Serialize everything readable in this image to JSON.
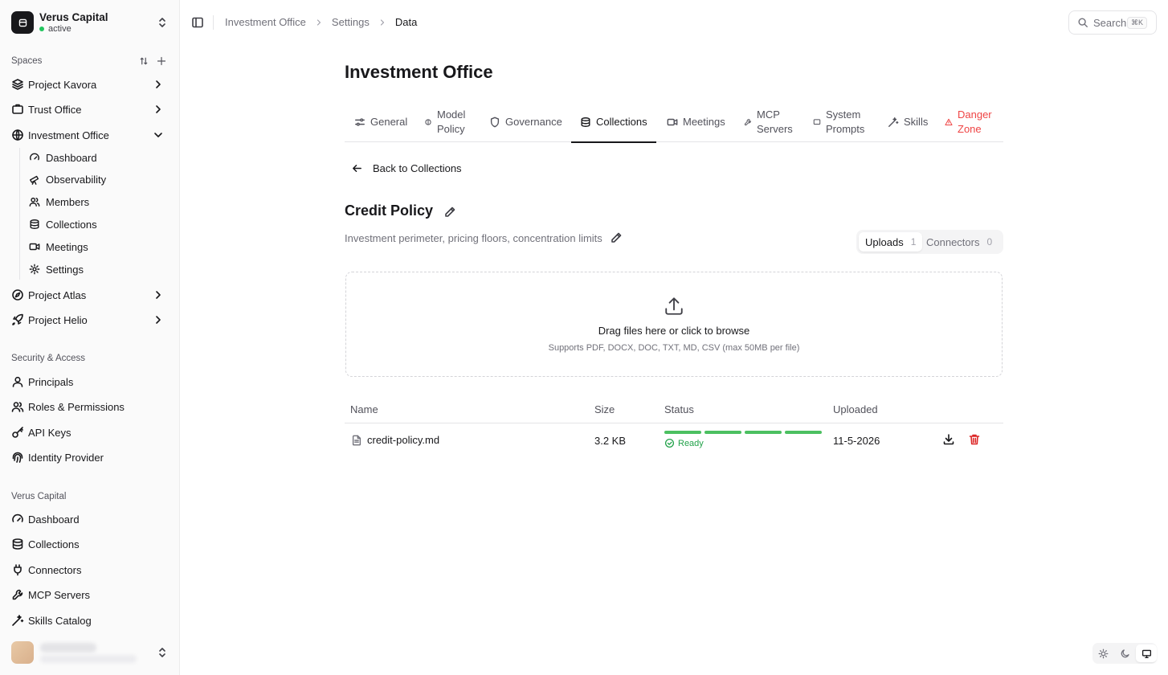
{
  "org": {
    "name": "Verus Capital",
    "status": "active"
  },
  "sidebar": {
    "spaces_label": "Spaces",
    "spaces": [
      {
        "label": "Project Kavora",
        "icon": "layers-icon"
      },
      {
        "label": "Trust Office",
        "icon": "building-icon"
      },
      {
        "label": "Investment Office",
        "icon": "globe-icon"
      }
    ],
    "investment_office_items": [
      {
        "label": "Dashboard",
        "icon": "gauge-icon"
      },
      {
        "label": "Observability",
        "icon": "telescope-icon"
      },
      {
        "label": "Members",
        "icon": "users-icon"
      },
      {
        "label": "Collections",
        "icon": "database-icon"
      },
      {
        "label": "Meetings",
        "icon": "video-icon"
      },
      {
        "label": "Settings",
        "icon": "gear-icon"
      }
    ],
    "more_spaces": [
      {
        "label": "Project Atlas",
        "icon": "compass-icon"
      },
      {
        "label": "Project Helio",
        "icon": "rocket-icon"
      }
    ],
    "security_label": "Security & Access",
    "security": [
      {
        "label": "Principals",
        "icon": "user-icon"
      },
      {
        "label": "Roles & Permissions",
        "icon": "users-icon"
      },
      {
        "label": "API Keys",
        "icon": "key-icon"
      },
      {
        "label": "Identity Provider",
        "icon": "fingerprint-icon"
      }
    ],
    "org_label": "Verus Capital",
    "org_items": [
      {
        "label": "Dashboard",
        "icon": "gauge-icon"
      },
      {
        "label": "Collections",
        "icon": "database-icon"
      },
      {
        "label": "Connectors",
        "icon": "plug-icon"
      },
      {
        "label": "MCP Servers",
        "icon": "wrench-icon"
      },
      {
        "label": "Skills Catalog",
        "icon": "wand-icon"
      }
    ]
  },
  "header": {
    "breadcrumbs": [
      "Investment Office",
      "Settings",
      "Data"
    ],
    "search_label": "Search",
    "search_kbd": "⌘K"
  },
  "main": {
    "title": "Investment Office",
    "tabs": [
      {
        "label": "General",
        "icon": "sliders-icon"
      },
      {
        "label": "Model Policy",
        "icon": "brain-icon"
      },
      {
        "label": "Governance",
        "icon": "shield-icon"
      },
      {
        "label": "Collections",
        "icon": "database-icon",
        "active": true
      },
      {
        "label": "Meetings",
        "icon": "video-icon"
      },
      {
        "label": "MCP Servers",
        "icon": "wrench-icon"
      },
      {
        "label": "System Prompts",
        "icon": "message-icon"
      },
      {
        "label": "Skills",
        "icon": "wand-icon"
      },
      {
        "label": "Danger Zone",
        "icon": "warning-icon",
        "danger": true
      }
    ],
    "back_label": "Back to Collections",
    "collection": {
      "title": "Credit Policy",
      "description": "Investment perimeter, pricing floors, concentration limits"
    },
    "segments": [
      {
        "label": "Uploads",
        "count": "1",
        "active": true
      },
      {
        "label": "Connectors",
        "count": "0"
      }
    ],
    "dropzone": {
      "title": "Drag files here or click to browse",
      "subtitle": "Supports PDF, DOCX, DOC, TXT, MD, CSV (max 50MB per file)"
    },
    "table": {
      "columns": [
        "Name",
        "Size",
        "Status",
        "Uploaded"
      ],
      "rows": [
        {
          "name": "credit-policy.md",
          "size": "3.2 KB",
          "status": "Ready",
          "progress": 1.0,
          "uploaded": "11-5-2026"
        }
      ]
    }
  },
  "colors": {
    "accent": "#18181b",
    "success": "#22a24a",
    "danger": "#dc2626",
    "progress": "#4cc061"
  }
}
